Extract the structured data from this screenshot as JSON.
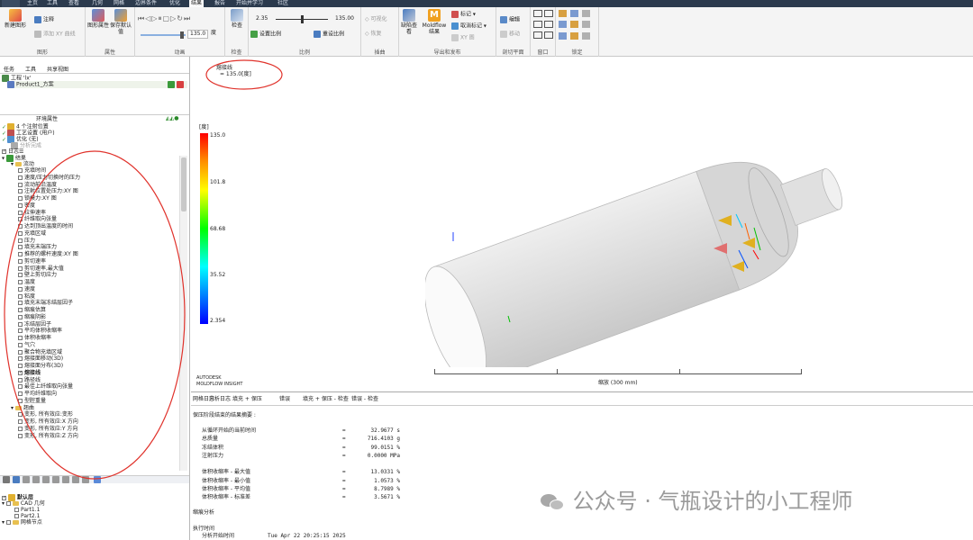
{
  "menubar": {
    "items": [
      "主页",
      "工具",
      "查看",
      "几何",
      "网格",
      "边界条件",
      "优化",
      "结果",
      "报告",
      "开始并学习",
      "社区"
    ],
    "active": "结果"
  },
  "ribbon": {
    "groups": {
      "shapes": "图形",
      "properties": "属性",
      "animation": "动画",
      "inspect": "检查",
      "scale": "比例",
      "drawing": "插曲",
      "export": "导出和发布",
      "cutplane": "剖切平面",
      "window": "窗口",
      "lock": "锁定"
    },
    "new_shape": "新建图形",
    "annotation": "注释",
    "add_xy": "添加 XY 曲线",
    "shape_props": "图形属性",
    "save_default": "保存默认值",
    "angle_value": "135.0",
    "angle_unit": "度",
    "inspect": "检查",
    "scale_min": "2.35",
    "scale_max": "135.00",
    "set_scale": "设置比例",
    "reset_scale": "重设比例",
    "visible": "可视化",
    "restore": "恢复",
    "defect_view": "缺陷查看",
    "moldflow": "Moldflow 结果",
    "mark": "标记",
    "unmark": "取消标记",
    "xy_chart": "XY 图",
    "edit": "编辑",
    "move": "移动"
  },
  "left": {
    "tabs": [
      "任务",
      "工具",
      "共享视图"
    ],
    "project": "工程 'lx'",
    "study": "Product1_方案",
    "env": "环境属性",
    "items": [
      "4 个注射位置",
      "工艺设置 (用户)",
      "优化 (无)",
      "分析完成",
      "日志",
      "结果",
      "流动"
    ],
    "results": [
      "充填时间",
      "速度/压力切换时的压力",
      "流动前沿温度",
      "注射位置处压力:XY 图",
      "锁模力:XY 图",
      "密度",
      "拉伸速率",
      "纤维取向张量",
      "达到顶出温度的时间",
      "充填区域",
      "压力",
      "填充末端压力",
      "推荐的螺杆速度:XY 图",
      "剪切速率",
      "剪切速率,最大值",
      "壁上剪切应力",
      "温度",
      "速度",
      "粘度",
      "填充末端冻结层因子",
      "缩痕估算",
      "缩痕阴影",
      "冻结层因子",
      "平均体积收缩率",
      "体积收缩率",
      "气穴",
      "聚合物充填区域",
      "熔接面移动(3D)",
      "熔接面分布(3D)",
      "熔接线",
      "路径线",
      "最佳上纤维取向张量",
      "平均纤维取向",
      "型腔重量"
    ],
    "checked_result": "熔接线",
    "warp_folder": "翘曲",
    "warp_items": [
      "变形, 所有效应:变形",
      "变形, 所有效应:X 方向",
      "变形, 所有效应:Y 方向",
      "变形, 所有效应:Z 方向"
    ],
    "layers": {
      "default": "默认层",
      "cad": "CAD 几何",
      "part1": "Part1.1",
      "part2": "Part2.1",
      "mesh": "网格节点"
    }
  },
  "viewport": {
    "result_name": "熔接线",
    "result_value": "= 135.0[度]",
    "legend_unit": "[度]",
    "legend_ticks": [
      "135.0",
      "101.8",
      "68.68",
      "35.52",
      "2.354"
    ],
    "brand1": "AUTODESK",
    "brand2": "MOLDFLOW INSIGHT",
    "scale_label": "缩放 (300 mm)"
  },
  "log": {
    "tabs": [
      "网格日志",
      "分析日志",
      "填充 + 保压",
      "错误",
      "填充 + 保压 - 检查",
      "错误 - 检查"
    ],
    "heading": "保压阶段结束的结果摘要 :",
    "rows": [
      [
        "从循环开始的当前时间",
        "=",
        "32.9677 s"
      ],
      [
        "总质量",
        "=",
        "716.4103 g"
      ],
      [
        "冻结体积",
        "=",
        "99.0151 %"
      ],
      [
        "注射压力",
        "=",
        "0.0000 MPa"
      ],
      [
        "",
        "",
        " "
      ],
      [
        "体积收缩率 - 最大值",
        "=",
        "13.0331 %"
      ],
      [
        "体积收缩率 - 最小值",
        "=",
        "1.0573 %"
      ],
      [
        "体积收缩率 - 平均值",
        "=",
        "8.7989 %"
      ],
      [
        "体积收缩率 - 标准差",
        "=",
        "3.5671 %"
      ]
    ],
    "section2": "缩痕分析",
    "section3": "执行时间",
    "start_label": "分析开始时间",
    "start_value": "Tue Apr 22 20:25:15 2025"
  },
  "watermark": "公众号 · 气瓶设计的小工程师",
  "colors": {
    "annotation": "#e0322b",
    "ribbon_bg": "#f4f4f4",
    "menubar_bg": "#2b3a4d"
  }
}
